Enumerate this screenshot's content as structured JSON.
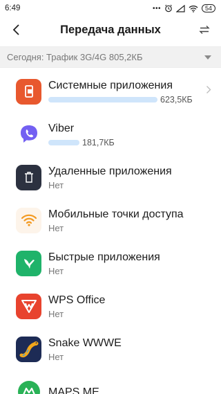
{
  "status": {
    "time": "6:49",
    "dots": "•••",
    "battery": "54"
  },
  "header": {
    "title": "Передача данных"
  },
  "filter": {
    "label": "Сегодня: Трафик 3G/4G 805,2КБ"
  },
  "apps": [
    {
      "name": "Системные приложения",
      "usage": "623,5КБ",
      "usage_fraction": 0.81,
      "color": "#e8582e",
      "icon": "system-apps-icon"
    },
    {
      "name": "Viber",
      "usage": "181,7КБ",
      "usage_fraction": 0.24,
      "color": "#ffffff",
      "icon": "viber-icon"
    },
    {
      "name": "Удаленные приложения",
      "detail": "Нет",
      "color": "#2c3140",
      "icon": "trash-icon"
    },
    {
      "name": "Мобильные точки доступа",
      "detail": "Нет",
      "color": "#fdf4ea",
      "icon": "wifi-hotspot-icon"
    },
    {
      "name": "Быстрые приложения",
      "detail": "Нет",
      "color": "#1fb36a",
      "icon": "hummingbird-icon"
    },
    {
      "name": "WPS Office",
      "detail": "Нет",
      "color": "#e8432e",
      "icon": "wps-icon"
    },
    {
      "name": "Snake WWWE",
      "detail": "Нет",
      "color": "#1d2b55",
      "icon": "snake-icon"
    },
    {
      "name": "MAPS.ME",
      "color": "#2ab257",
      "icon": "maps-me-icon"
    }
  ]
}
